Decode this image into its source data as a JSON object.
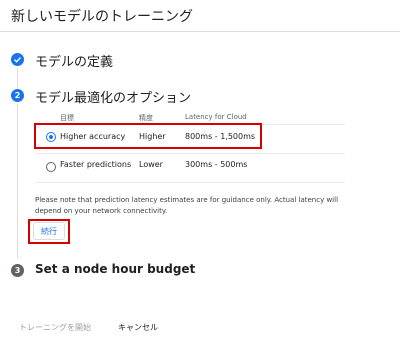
{
  "header": {
    "title": "新しいモデルのトレーニング"
  },
  "steps": [
    {
      "number": "1",
      "title": "モデルの定義",
      "state": "complete"
    },
    {
      "number": "2",
      "title": "モデル最適化のオプション",
      "state": "active"
    },
    {
      "number": "3",
      "title": "Set a node hour budget",
      "state": "pending"
    }
  ],
  "optimization_table": {
    "headers": [
      "目標",
      "精度",
      "Latency for Cloud"
    ],
    "rows": [
      {
        "goal": "Higher accuracy",
        "accuracy": "Higher",
        "latency": "800ms - 1,500ms",
        "selected": true
      },
      {
        "goal": "Faster predictions",
        "accuracy": "Lower",
        "latency": "300ms - 500ms",
        "selected": false
      }
    ]
  },
  "note": "Please note that prediction latency estimates are for guidance only. Actual latency will depend on your network connectivity.",
  "continue_label": "続行",
  "footer": {
    "start_label": "トレーニングを開始",
    "cancel_label": "キャンセル"
  },
  "colors": {
    "accent": "#1a73e8",
    "highlight": "#d50000",
    "disabled_text": "#9aa0a6"
  }
}
